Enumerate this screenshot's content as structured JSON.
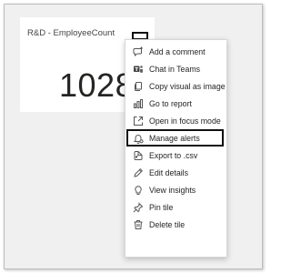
{
  "tile": {
    "title": "R&D - EmployeeCount",
    "value": "1028"
  },
  "menu": {
    "items": [
      {
        "label": "Add a comment",
        "icon": "comment-add-icon"
      },
      {
        "label": "Chat in Teams",
        "icon": "teams-icon"
      },
      {
        "label": "Copy visual as image",
        "icon": "copy-icon"
      },
      {
        "label": "Go to report",
        "icon": "report-icon"
      },
      {
        "label": "Open in focus mode",
        "icon": "focus-mode-icon"
      },
      {
        "label": "Manage alerts",
        "icon": "alert-bell-icon",
        "highlighted": true
      },
      {
        "label": "Export to .csv",
        "icon": "export-icon"
      },
      {
        "label": "Edit details",
        "icon": "edit-pencil-icon"
      },
      {
        "label": "View insights",
        "icon": "lightbulb-icon"
      },
      {
        "label": "Pin tile",
        "icon": "pin-icon"
      },
      {
        "label": "Delete tile",
        "icon": "trash-icon"
      }
    ]
  },
  "colors": {
    "text": "#252423",
    "highlight_border": "#111111"
  }
}
